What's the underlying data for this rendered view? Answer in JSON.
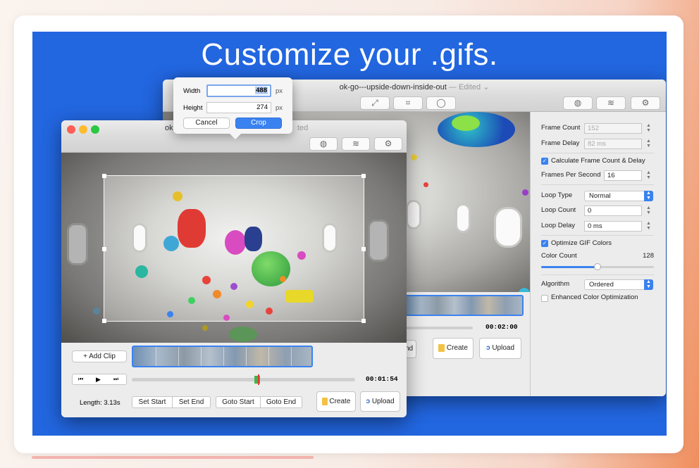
{
  "headline": "Customize your .gifs.",
  "back_window": {
    "title": "ok-go---upside-down-inside-out",
    "edited": "— Edited",
    "timecode": "00:02:00",
    "create_label": "Create",
    "upload_label": "Upload",
    "partial_label": "nd"
  },
  "settings": {
    "frame_count_label": "Frame Count",
    "frame_count_value": "152",
    "frame_delay_label": "Frame Delay",
    "frame_delay_value": "82 ms",
    "calc_label": "Calculate Frame Count & Delay",
    "fps_label": "Frames Per Second",
    "fps_value": "16",
    "loop_type_label": "Loop Type",
    "loop_type_value": "Normal",
    "loop_count_label": "Loop Count",
    "loop_count_value": "0",
    "loop_delay_label": "Loop Delay",
    "loop_delay_value": "0 ms",
    "optimize_label": "Optimize GIF Colors",
    "color_count_label": "Color Count",
    "color_count_value": "128",
    "color_count_slider": 0.5,
    "algorithm_label": "Algorithm",
    "algorithm_value": "Ordered",
    "enhanced_label": "Enhanced Color Optimization"
  },
  "front_window": {
    "title_partial": "ok",
    "edited_partial": "ted",
    "add_clip_label": "+ Add Clip",
    "timecode": "00:01:54",
    "length_label": "Length: 3.13s",
    "set_start_label": "Set Start",
    "set_end_label": "Set End",
    "goto_start_label": "Goto Start",
    "goto_end_label": "Goto End",
    "create_label": "Create",
    "upload_label": "Upload"
  },
  "crop_popover": {
    "width_label": "Width",
    "width_value": "488",
    "height_label": "Height",
    "height_value": "274",
    "unit": "px",
    "cancel_label": "Cancel",
    "crop_label": "Crop"
  },
  "colors": {
    "stage_blue": "#2266e0",
    "accent": "#3a82f0"
  }
}
